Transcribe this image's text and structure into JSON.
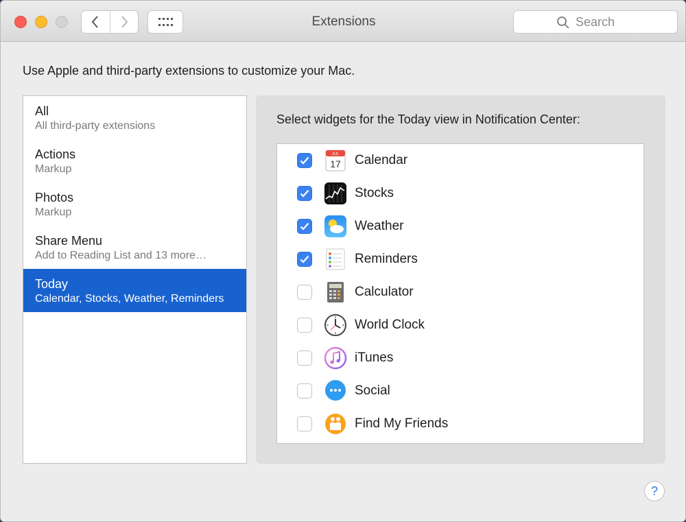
{
  "window": {
    "title": "Extensions",
    "search_placeholder": "Search"
  },
  "description": "Use Apple and third-party extensions to customize your Mac.",
  "categories": [
    {
      "title": "All",
      "subtitle": "All third-party extensions",
      "selected": false
    },
    {
      "title": "Actions",
      "subtitle": "Markup",
      "selected": false
    },
    {
      "title": "Photos",
      "subtitle": "Markup",
      "selected": false
    },
    {
      "title": "Share Menu",
      "subtitle": "Add to Reading List and 13 more…",
      "selected": false
    },
    {
      "title": "Today",
      "subtitle": "Calendar, Stocks, Weather, Reminders",
      "selected": true
    }
  ],
  "panel": {
    "heading": "Select widgets for the Today view in Notification Center:",
    "widgets": [
      {
        "label": "Calendar",
        "checked": true,
        "icon": "calendar-icon"
      },
      {
        "label": "Stocks",
        "checked": true,
        "icon": "stocks-icon"
      },
      {
        "label": "Weather",
        "checked": true,
        "icon": "weather-icon"
      },
      {
        "label": "Reminders",
        "checked": true,
        "icon": "reminders-icon"
      },
      {
        "label": "Calculator",
        "checked": false,
        "icon": "calculator-icon"
      },
      {
        "label": "World Clock",
        "checked": false,
        "icon": "world-clock-icon"
      },
      {
        "label": "iTunes",
        "checked": false,
        "icon": "itunes-icon"
      },
      {
        "label": "Social",
        "checked": false,
        "icon": "social-icon"
      },
      {
        "label": "Find My Friends",
        "checked": false,
        "icon": "find-my-friends-icon"
      }
    ]
  },
  "calendar_icon": {
    "month": "JUL",
    "day": "17"
  },
  "help_label": "?",
  "colors": {
    "selection": "#1862cf",
    "checkbox_on": "#3b82f0"
  }
}
